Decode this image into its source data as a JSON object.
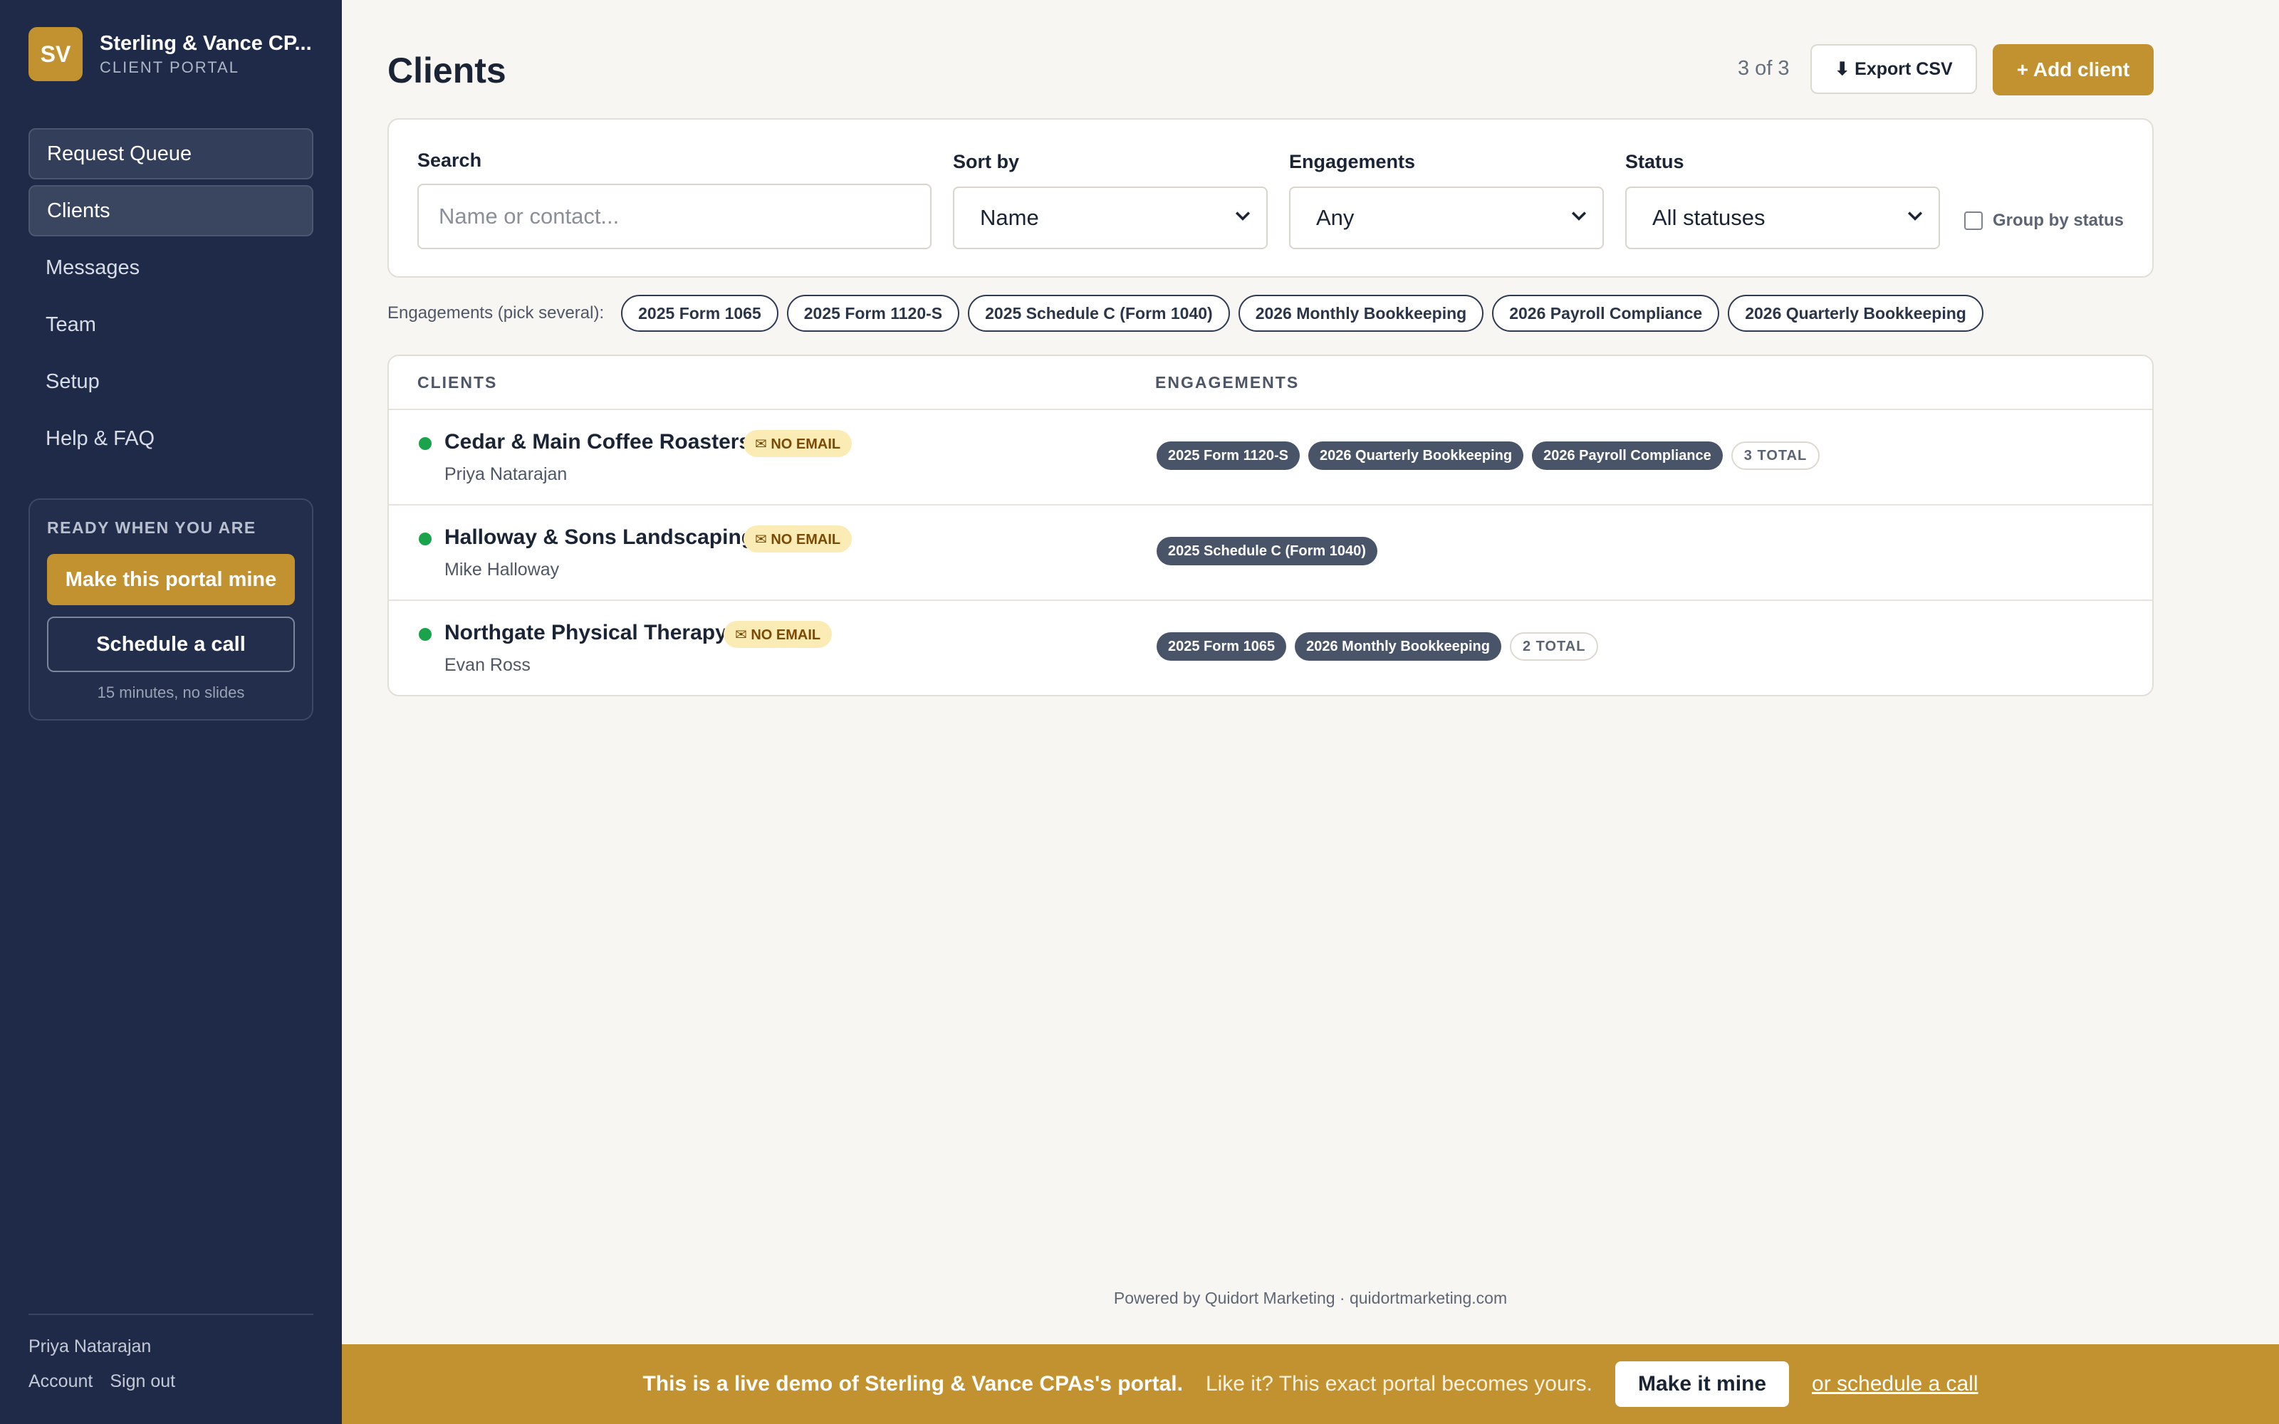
{
  "brand": {
    "initials": "SV",
    "name": "Sterling & Vance CP...",
    "subtitle": "CLIENT PORTAL",
    "accent": "#c1922f"
  },
  "sidebar": {
    "items": [
      {
        "label": "Request Queue"
      },
      {
        "label": "Clients"
      },
      {
        "label": "Messages"
      },
      {
        "label": "Team"
      },
      {
        "label": "Setup"
      },
      {
        "label": "Help & FAQ"
      }
    ],
    "cta": {
      "title": "READY WHEN YOU ARE",
      "primary": "Make this portal mine",
      "secondary": "Schedule a call",
      "note": "15 minutes, no slides"
    },
    "footer": {
      "user": "Priya Natarajan",
      "account": "Account",
      "signout": "Sign out"
    }
  },
  "header": {
    "title": "Clients",
    "count": "3 of 3",
    "export_label": "⬇ Export CSV",
    "add_label": "+ Add client"
  },
  "filters": {
    "search_label": "Search",
    "search_placeholder": "Name or contact...",
    "sort_label": "Sort by",
    "sort_value": "Name",
    "engagements_label": "Engagements",
    "engagements_value": "Any",
    "status_label": "Status",
    "status_value": "All statuses",
    "group_label": "Group by status"
  },
  "engagement_chips": {
    "label": "Engagements (pick several):",
    "items": [
      "2025 Form 1065",
      "2025 Form 1120-S",
      "2025 Schedule C (Form 1040)",
      "2026 Monthly Bookkeeping",
      "2026 Payroll Compliance",
      "2026 Quarterly Bookkeeping"
    ]
  },
  "table": {
    "headers": {
      "clients": "CLIENTS",
      "engagements": "ENGAGEMENTS"
    },
    "badge_no_email": "✉ NO EMAIL",
    "rows": [
      {
        "name": "Cedar & Main Coffee Roasters",
        "contact": "Priya Natarajan",
        "tags": [
          "2025 Form 1120-S",
          "2026 Quarterly Bookkeeping",
          "2026 Payroll Compliance"
        ],
        "total": "3 TOTAL"
      },
      {
        "name": "Halloway & Sons Landscaping",
        "contact": "Mike Halloway",
        "tags": [
          "2025 Schedule C (Form 1040)"
        ],
        "total": ""
      },
      {
        "name": "Northgate Physical Therapy",
        "contact": "Evan Ross",
        "tags": [
          "2025 Form 1065",
          "2026 Monthly Bookkeeping"
        ],
        "total": "2 TOTAL"
      }
    ]
  },
  "footer": {
    "powered": "Powered by Quidort Marketing · quidortmarketing.com"
  },
  "banner": {
    "strong": "This is a live demo of Sterling & Vance CPAs's portal.",
    "soft": "Like it? This exact portal becomes yours.",
    "button": "Make it mine",
    "link": "or schedule a call"
  }
}
